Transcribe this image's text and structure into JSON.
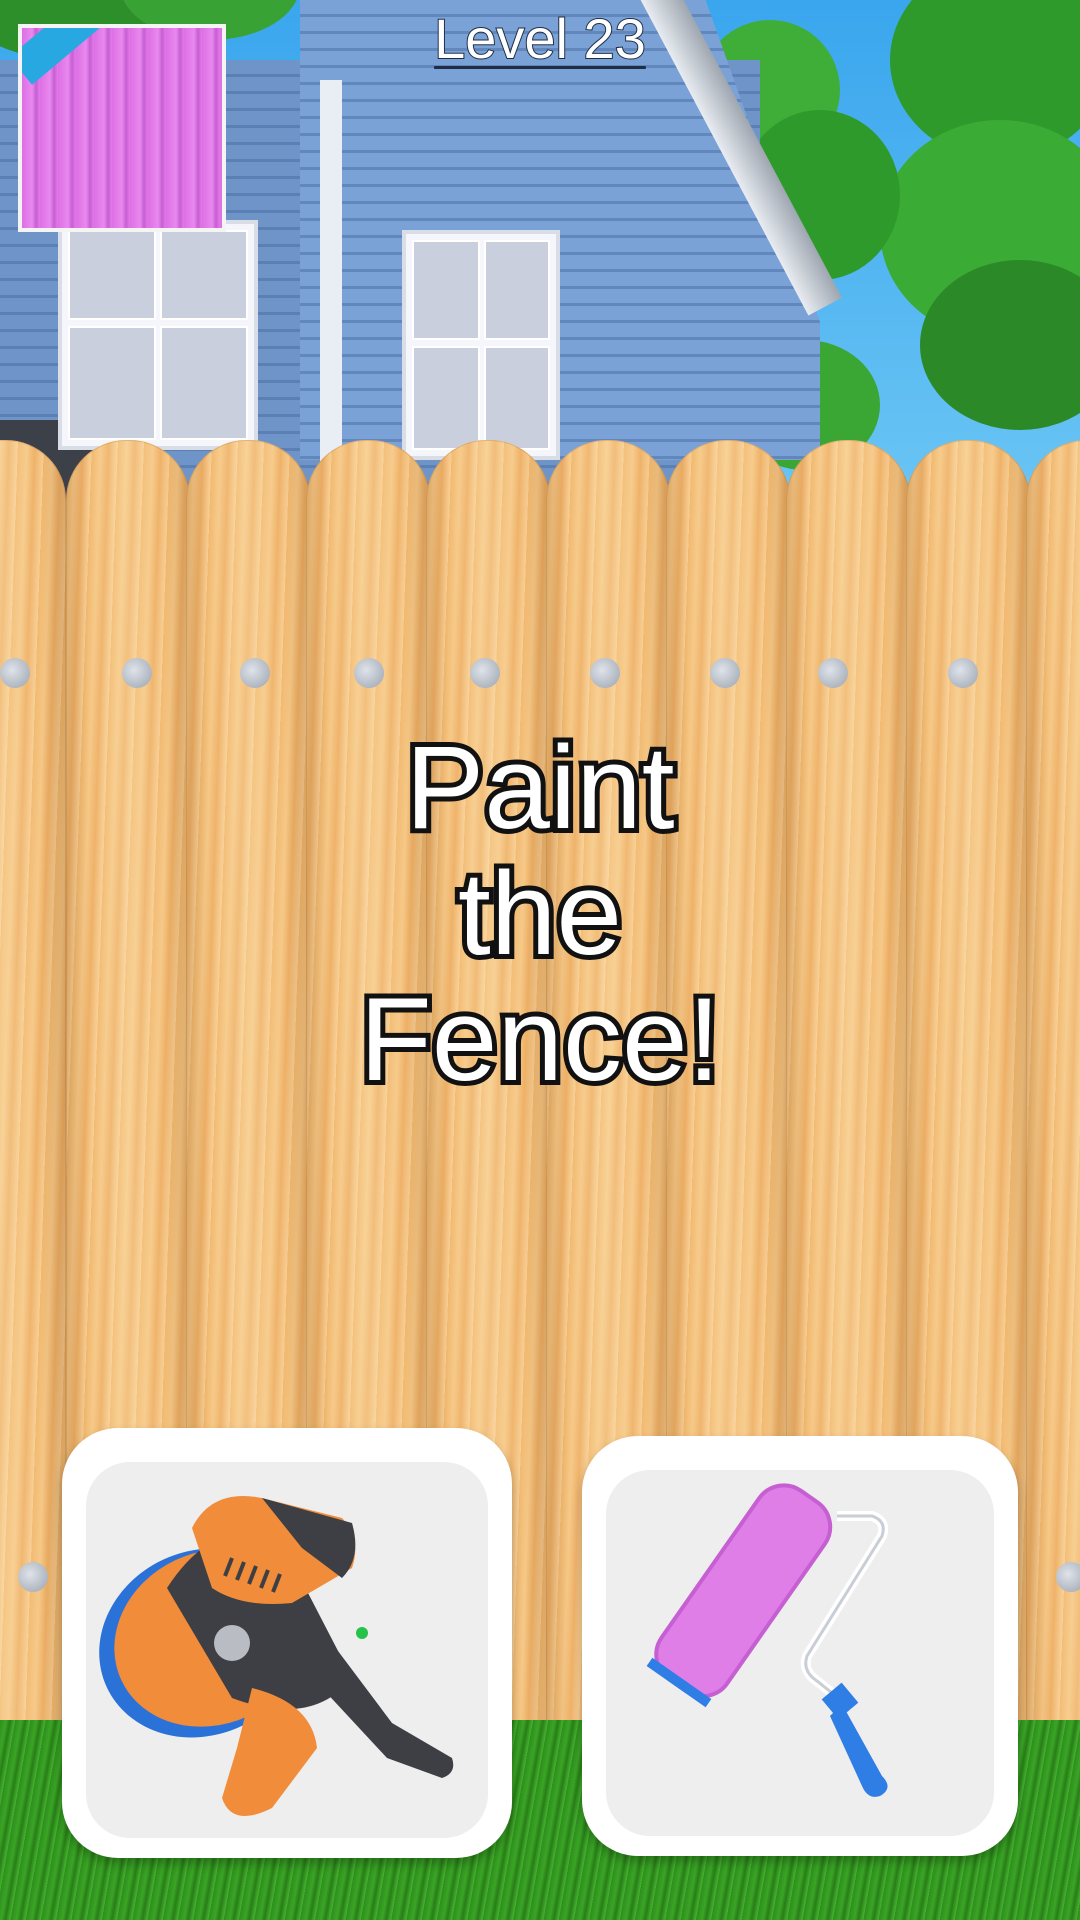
{
  "header": {
    "level_label": "Level 23"
  },
  "prompt": {
    "line1": "Paint",
    "line2": "the",
    "line3": "Fence!"
  },
  "preview": {
    "fill_color": "#dd6fe6"
  },
  "tools": [
    {
      "name": "sander",
      "icon": "orbital-sander-icon",
      "colors": [
        "#f08c3a",
        "#3d3f44",
        "#2a72d8"
      ]
    },
    {
      "name": "paint-roller",
      "icon": "paint-roller-icon",
      "colors": [
        "#e07ee8",
        "#ffffff",
        "#2f7ee6"
      ]
    }
  ]
}
